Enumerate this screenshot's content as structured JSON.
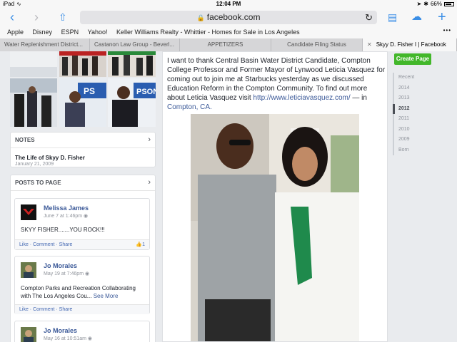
{
  "statusbar": {
    "device": "iPad",
    "time": "12:04 PM",
    "battery": "66%"
  },
  "toolbar": {
    "url": "facebook.com"
  },
  "bookmarks": [
    "Apple",
    "Disney",
    "ESPN",
    "Yahoo!",
    "Keller Williams Realty - Whittier - Homes for Sale in Los Angeles"
  ],
  "tabs": [
    {
      "label": "Water Replenishment District..."
    },
    {
      "label": "Castanon Law Group - Beverl..."
    },
    {
      "label": "APPETIZERS"
    },
    {
      "label": "Candidate Filing Status"
    },
    {
      "label": "Skyy D. Fisher I | Facebook"
    }
  ],
  "notes": {
    "header": "NOTES",
    "title": "The Life of Skyy D. Fisher",
    "date": "January 21, 2009"
  },
  "posts_to_page": {
    "header": "POSTS TO PAGE",
    "posts": [
      {
        "name": "Melissa James",
        "meta": "June 7 at 1:46pm",
        "text": "SKYY FISHER.......YOU ROCK!!!",
        "like": "Like",
        "comment": "Comment",
        "share": "Share",
        "likes_count": "1"
      },
      {
        "name": "Jo Morales",
        "meta": "May 19 at 7:46pm",
        "text_line1": "Compton Parks and Recreation Collaborating",
        "text_line2": "with The Los Angeles Cou...",
        "see_more": "See More",
        "like": "Like",
        "comment": "Comment",
        "share": "Share"
      },
      {
        "name": "Jo Morales",
        "meta": "May 16 at 10:51am"
      }
    ]
  },
  "main_post": {
    "text": "I want to thank Central Basin Water District Candidate, Compton College Professor and Former Mayor of Lynwood Leticia Vasquez for coming out to join me at Starbucks yesterday as we discussed Education Reform in the Compton Community. To find out more about Leticia Vasquez visit ",
    "link": "http://www.leticiavasquez.com/",
    "suffix": " — in ",
    "place": "Compton, CA."
  },
  "right_sidebar": {
    "create_page": "Create Page",
    "years": [
      "Recent",
      "2014",
      "2013",
      "2012",
      "2011",
      "2010",
      "2009",
      "Born"
    ],
    "active_year": "2012"
  },
  "colors": {
    "facebook_blue": "#3b5998",
    "safari_blue": "#3a8ee6",
    "create_green": "#42b72a"
  }
}
